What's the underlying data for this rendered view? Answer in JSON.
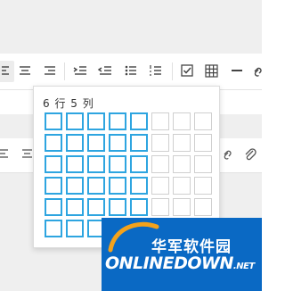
{
  "toolbar": {
    "buttons": [
      {
        "name": "align-left-icon",
        "active": true
      },
      {
        "name": "align-center-icon"
      },
      {
        "name": "align-right-icon"
      },
      {
        "name": "indent-icon"
      },
      {
        "name": "outdent-icon"
      },
      {
        "name": "bullet-list-icon"
      },
      {
        "name": "numbered-list-icon"
      },
      {
        "name": "checkbox-icon"
      },
      {
        "name": "table-icon"
      },
      {
        "name": "horizontal-rule-icon"
      },
      {
        "name": "link-icon"
      }
    ]
  },
  "toolbar2": {
    "buttons": [
      {
        "name": "align-left-icon"
      },
      {
        "name": "align-center-icon"
      },
      {
        "name": "link-icon"
      },
      {
        "name": "attachment-icon"
      }
    ]
  },
  "table_picker": {
    "label": "6 行 5 列",
    "rows_selected": 6,
    "cols_selected": 5,
    "total_rows": 6,
    "total_cols": 8,
    "selected_color": "#2ea5e0"
  },
  "watermark": {
    "cn": "华军软件园",
    "en": "ONLINEDOWN",
    "suffix": ".NET",
    "bg_color": "#0a69c4"
  }
}
